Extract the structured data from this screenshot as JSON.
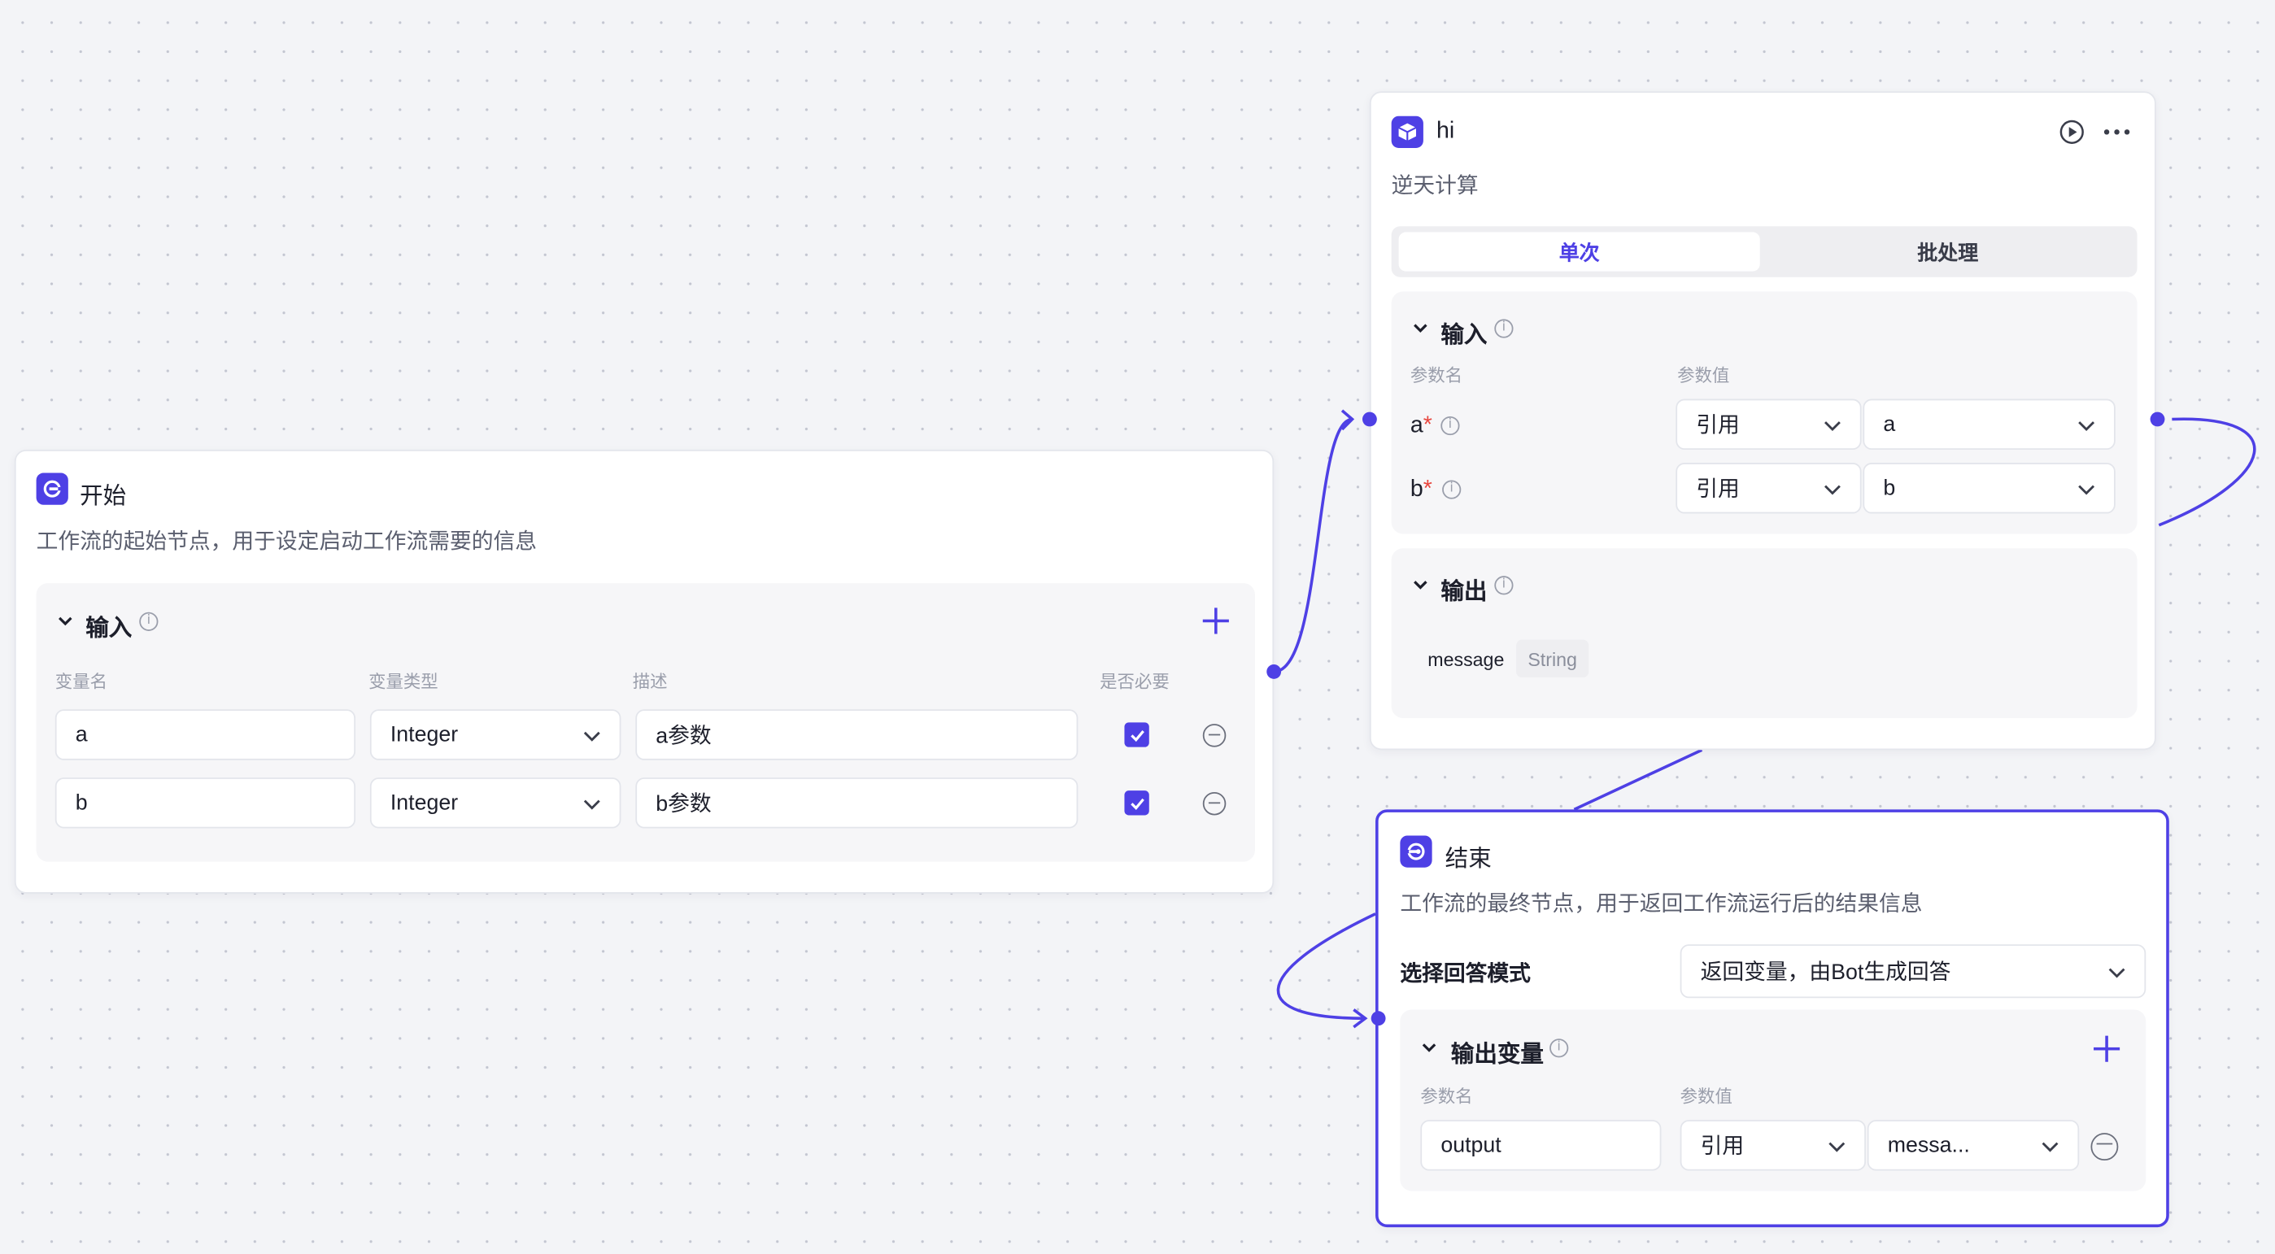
{
  "colors": {
    "accent": "#4e40e5",
    "required": "#e8463e",
    "canvas": "#f3f4f7"
  },
  "start_node": {
    "title": "开始",
    "icon": "start-icon",
    "description": "工作流的起始节点，用于设定启动工作流需要的信息",
    "input_section": {
      "title": "输入",
      "columns": [
        "变量名",
        "变量类型",
        "描述",
        "是否必要"
      ],
      "rows": [
        {
          "name": "a",
          "type": "Integer",
          "desc": "a参数",
          "required": true
        },
        {
          "name": "b",
          "type": "Integer",
          "desc": "b参数",
          "required": true
        }
      ]
    }
  },
  "hi_node": {
    "title": "hi",
    "icon": "cube-icon",
    "description": "逆天计算",
    "tabs": [
      "单次",
      "批处理"
    ],
    "active_tab": "单次",
    "input_section": {
      "title": "输入",
      "columns": [
        "参数名",
        "参数值"
      ],
      "rows": [
        {
          "name": "a",
          "required_mark": "*",
          "mode": "引用",
          "value": "a"
        },
        {
          "name": "b",
          "required_mark": "*",
          "mode": "引用",
          "value": "b"
        }
      ]
    },
    "output_section": {
      "title": "输出",
      "items": [
        {
          "name": "message",
          "type": "String"
        }
      ]
    }
  },
  "end_node": {
    "title": "结束",
    "icon": "end-icon",
    "description": "工作流的最终节点，用于返回工作流运行后的结果信息",
    "answer_mode_label": "选择回答模式",
    "answer_mode_value": "返回变量，由Bot生成回答",
    "output_section": {
      "title": "输出变量",
      "columns": [
        "参数名",
        "参数值"
      ],
      "rows": [
        {
          "name": "output",
          "mode": "引用",
          "value": "messa..."
        }
      ]
    }
  }
}
